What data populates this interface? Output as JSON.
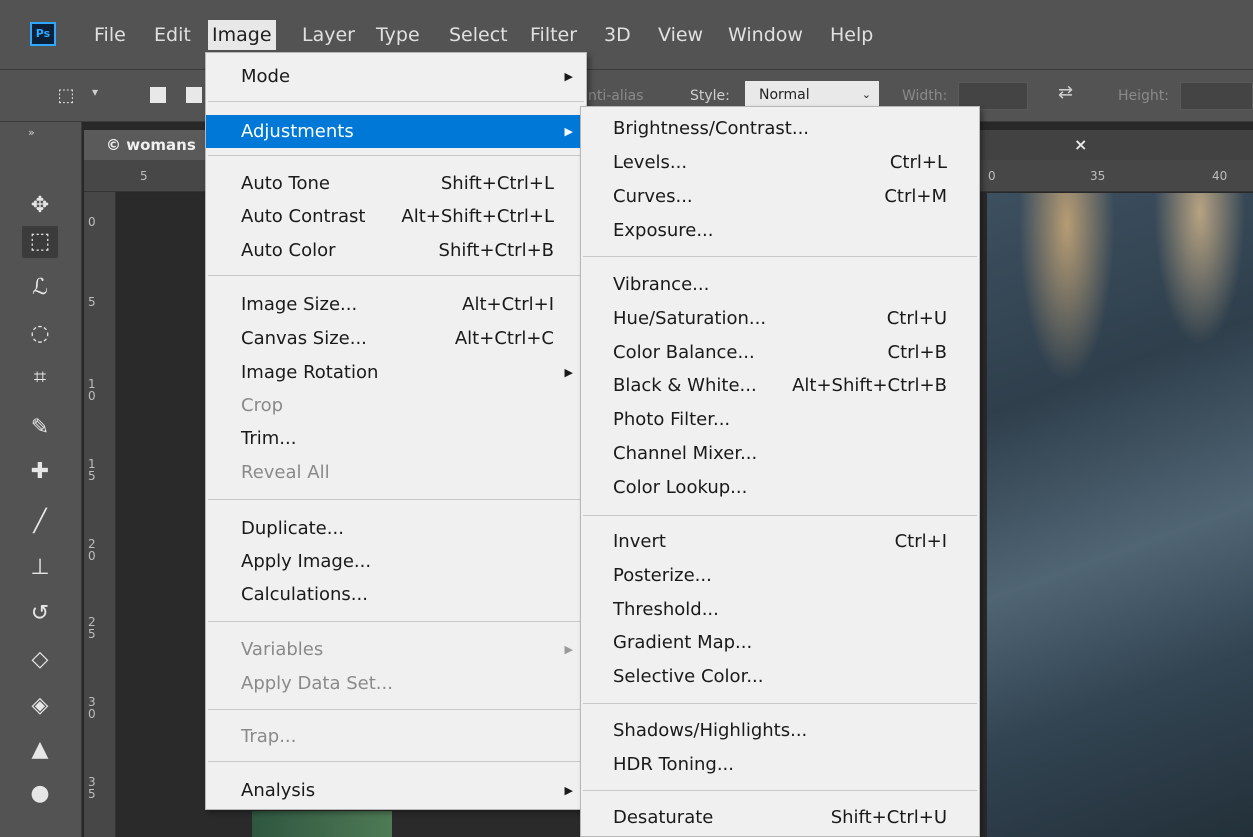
{
  "app": {
    "logo_text": "Ps"
  },
  "menubar": {
    "items": [
      "File",
      "Edit",
      "Image",
      "Layer",
      "Type",
      "Select",
      "Filter",
      "3D",
      "View",
      "Window",
      "Help"
    ],
    "active": "Image"
  },
  "options_bar": {
    "anti_alias_label": "nti-alias",
    "style_label": "Style:",
    "style_value": "Normal",
    "width_label": "Width:",
    "height_label": "Height:"
  },
  "document": {
    "tab_title": "© womans",
    "close_symbol": "×"
  },
  "rulers": {
    "top_ticks": [
      "5",
      "0",
      "35",
      "40"
    ],
    "left_ticks": [
      "0",
      "5",
      "1\n0",
      "1\n5",
      "2\n0",
      "2\n5",
      "3\n0",
      "3\n5"
    ]
  },
  "image_menu": {
    "items": [
      {
        "label": "Mode",
        "submenu": true
      },
      {
        "label": "Adjustments",
        "submenu": true,
        "highlighted": true
      },
      {
        "label": "Auto Tone",
        "shortcut": "Shift+Ctrl+L"
      },
      {
        "label": "Auto Contrast",
        "shortcut": "Alt+Shift+Ctrl+L"
      },
      {
        "label": "Auto Color",
        "shortcut": "Shift+Ctrl+B"
      },
      {
        "label": "Image Size...",
        "shortcut": "Alt+Ctrl+I"
      },
      {
        "label": "Canvas Size...",
        "shortcut": "Alt+Ctrl+C"
      },
      {
        "label": "Image Rotation",
        "submenu": true
      },
      {
        "label": "Crop",
        "disabled": true
      },
      {
        "label": "Trim..."
      },
      {
        "label": "Reveal All",
        "disabled": true
      },
      {
        "label": "Duplicate..."
      },
      {
        "label": "Apply Image..."
      },
      {
        "label": "Calculations..."
      },
      {
        "label": "Variables",
        "submenu": true,
        "disabled": true
      },
      {
        "label": "Apply Data Set...",
        "disabled": true
      },
      {
        "label": "Trap...",
        "disabled": true
      },
      {
        "label": "Analysis",
        "submenu": true
      }
    ]
  },
  "adjustments_menu": {
    "items": [
      {
        "label": "Brightness/Contrast..."
      },
      {
        "label": "Levels...",
        "shortcut": "Ctrl+L"
      },
      {
        "label": "Curves...",
        "shortcut": "Ctrl+M"
      },
      {
        "label": "Exposure..."
      },
      {
        "label": "Vibrance..."
      },
      {
        "label": "Hue/Saturation...",
        "shortcut": "Ctrl+U"
      },
      {
        "label": "Color Balance...",
        "shortcut": "Ctrl+B"
      },
      {
        "label": "Black & White...",
        "shortcut": "Alt+Shift+Ctrl+B"
      },
      {
        "label": "Photo Filter..."
      },
      {
        "label": "Channel Mixer..."
      },
      {
        "label": "Color Lookup..."
      },
      {
        "label": "Invert",
        "shortcut": "Ctrl+I"
      },
      {
        "label": "Posterize..."
      },
      {
        "label": "Threshold..."
      },
      {
        "label": "Gradient Map..."
      },
      {
        "label": "Selective Color..."
      },
      {
        "label": "Shadows/Highlights..."
      },
      {
        "label": "HDR Toning..."
      },
      {
        "label": "Desaturate",
        "shortcut": "Shift+Ctrl+U"
      }
    ]
  },
  "toolbar": {
    "tools": [
      "move-tool",
      "rectangular-marquee-tool",
      "lasso-tool",
      "quick-selection-tool",
      "crop-tool",
      "eyedropper-tool",
      "healing-brush-tool",
      "brush-tool",
      "clone-stamp-tool",
      "history-brush-tool",
      "eraser-tool",
      "paint-bucket-tool",
      "sharpen-tool",
      "dodge-tool"
    ],
    "selected": "rectangular-marquee-tool"
  },
  "colors": {
    "accent": "#0078d7",
    "panel": "#535353",
    "menu_bg": "#f0f0f0"
  }
}
